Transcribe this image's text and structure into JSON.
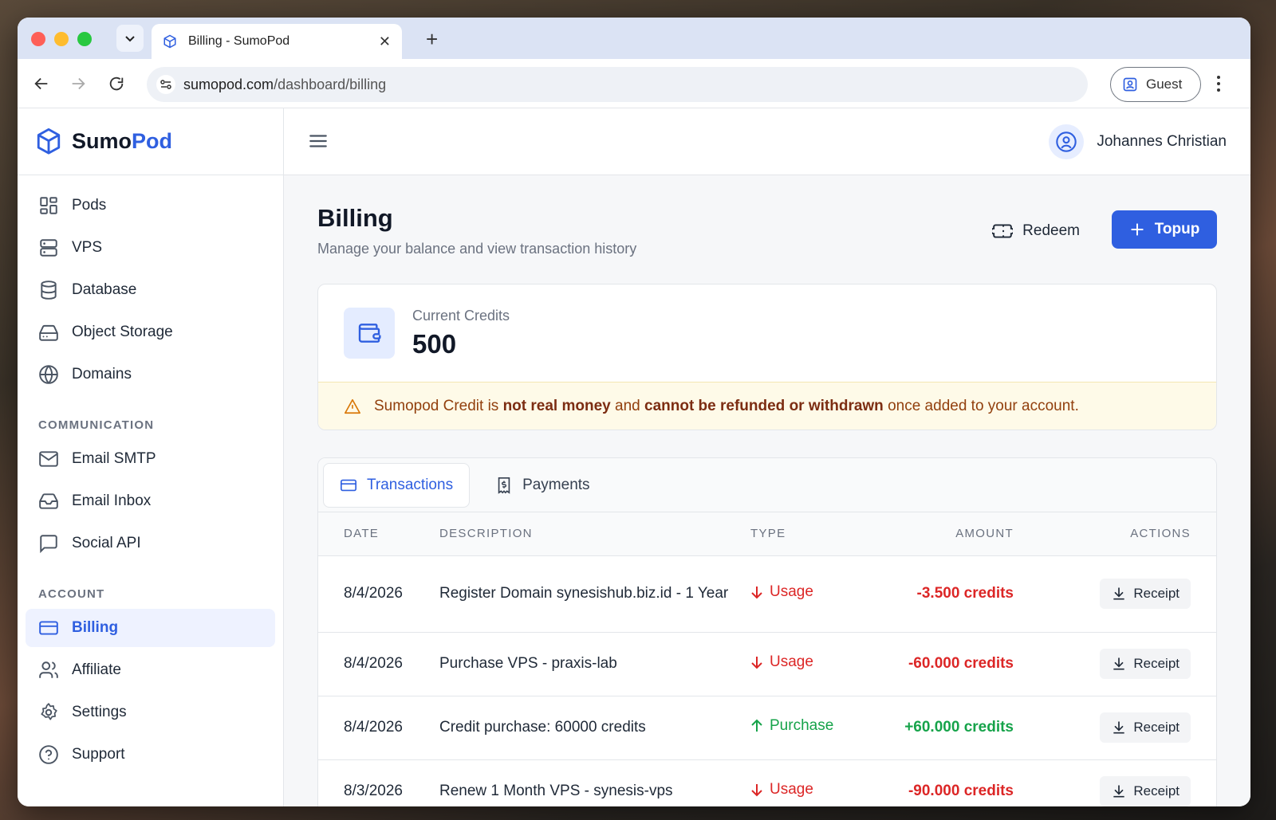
{
  "browser": {
    "tab_title": "Billing - SumoPod",
    "url_host": "sumopod.com",
    "url_path": "/dashboard/billing",
    "profile_label": "Guest"
  },
  "sidebar": {
    "logo_part1": "Sumo",
    "logo_part2": "Pod",
    "items_main": [
      {
        "label": "Pods",
        "icon": "grid-icon"
      },
      {
        "label": "VPS",
        "icon": "server-icon"
      },
      {
        "label": "Database",
        "icon": "database-icon"
      },
      {
        "label": "Object Storage",
        "icon": "hard-drive-icon"
      },
      {
        "label": "Domains",
        "icon": "globe-icon"
      }
    ],
    "section_communication": "COMMUNICATION",
    "items_communication": [
      {
        "label": "Email SMTP",
        "icon": "mail-icon"
      },
      {
        "label": "Email Inbox",
        "icon": "inbox-icon"
      },
      {
        "label": "Social API",
        "icon": "message-square-icon"
      }
    ],
    "section_account": "ACCOUNT",
    "items_account": [
      {
        "label": "Billing",
        "icon": "credit-card-icon",
        "active": true
      },
      {
        "label": "Affiliate",
        "icon": "users-icon"
      },
      {
        "label": "Settings",
        "icon": "gear-icon"
      },
      {
        "label": "Support",
        "icon": "help-circle-icon"
      }
    ]
  },
  "header": {
    "user_name": "Johannes Christian"
  },
  "page": {
    "title": "Billing",
    "subtitle": "Manage your balance and view transaction history",
    "redeem_label": "Redeem",
    "topup_label": "Topup"
  },
  "credits": {
    "label": "Current Credits",
    "value": "500"
  },
  "warning": {
    "part1": "Sumopod Credit is ",
    "bold1": "not real money",
    "part2": " and ",
    "bold2": "cannot be refunded or withdrawn",
    "part3": " once added to your account."
  },
  "tabs": {
    "transactions": "Transactions",
    "payments": "Payments"
  },
  "table": {
    "headers": {
      "date": "DATE",
      "description": "DESCRIPTION",
      "type": "TYPE",
      "amount": "AMOUNT",
      "actions": "ACTIONS"
    },
    "rows": [
      {
        "date": "8/4/2026",
        "description": "Register Domain synesishub.biz.id - 1 Year",
        "type": "Usage",
        "amount": "-3.500 credits",
        "action": "Receipt"
      },
      {
        "date": "8/4/2026",
        "description": "Purchase VPS - praxis-lab",
        "type": "Usage",
        "amount": "-60.000 credits",
        "action": "Receipt"
      },
      {
        "date": "8/4/2026",
        "description": "Credit purchase: 60000 credits",
        "type": "Purchase",
        "amount": "+60.000 credits",
        "action": "Receipt"
      },
      {
        "date": "8/3/2026",
        "description": "Renew 1 Month VPS - synesis-vps",
        "type": "Usage",
        "amount": "-90.000 credits",
        "action": "Receipt"
      }
    ]
  },
  "colors": {
    "accent": "#2f5fe0",
    "usage": "#dc2626",
    "purchase": "#16a34a",
    "warning_bg": "#fefae8"
  }
}
